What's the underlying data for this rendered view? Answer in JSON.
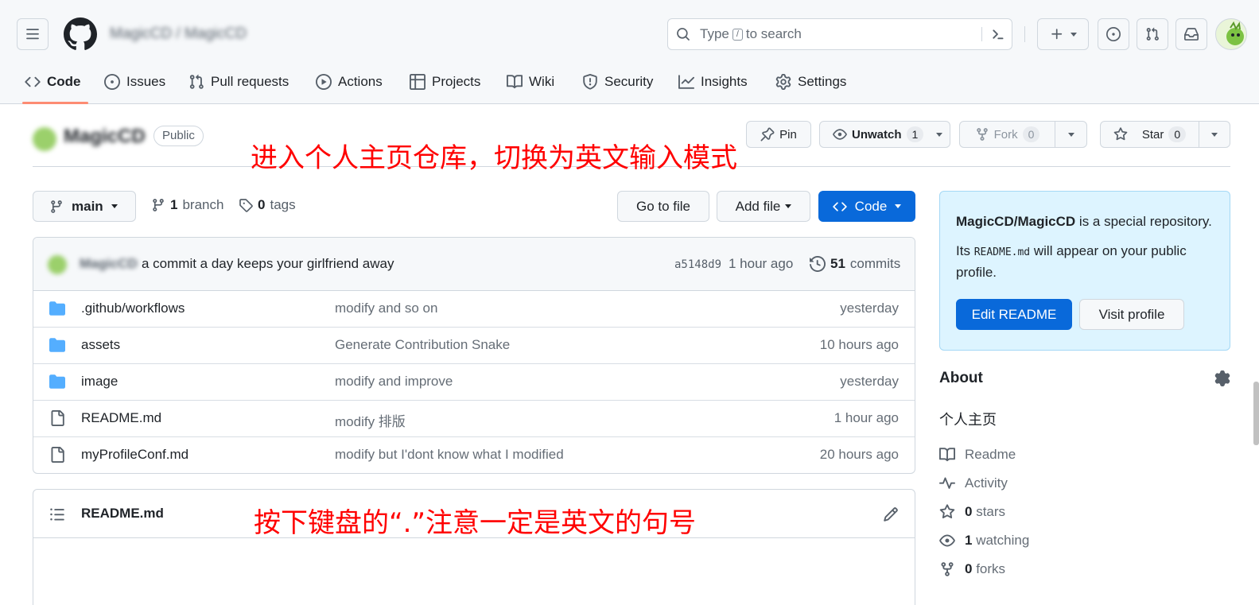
{
  "header": {
    "repo_path": "MagicCD / MagicCD",
    "search_text_before": "Type",
    "search_key": "/",
    "search_text_after": "to search"
  },
  "tabs": [
    {
      "label": "Code"
    },
    {
      "label": "Issues"
    },
    {
      "label": "Pull requests"
    },
    {
      "label": "Actions"
    },
    {
      "label": "Projects"
    },
    {
      "label": "Wiki"
    },
    {
      "label": "Security"
    },
    {
      "label": "Insights"
    },
    {
      "label": "Settings"
    }
  ],
  "repo": {
    "name": "MagicCD",
    "visibility": "Public",
    "pin_label": "Pin",
    "unwatch_label": "Unwatch",
    "watch_count": "1",
    "fork_label": "Fork",
    "fork_count": "0",
    "star_label": "Star",
    "star_count": "0"
  },
  "annotations": {
    "top": "进入个人主页仓库，切换为英文输入模式",
    "bottom": "按下键盘的“.”注意一定是英文的句号"
  },
  "branch_bar": {
    "branch_name": "main",
    "branch_count": "1",
    "branch_label": "branch",
    "tag_count": "0",
    "tag_label": "tags",
    "goto_file": "Go to file",
    "add_file": "Add file",
    "code_button": "Code"
  },
  "commit": {
    "author": "MagicCD",
    "message": "a commit a day keeps your girlfriend away",
    "hash": "a5148d9",
    "time": "1 hour ago",
    "count": "51",
    "count_label": "commits"
  },
  "files": [
    {
      "name": ".github/workflows",
      "type": "folder",
      "message": "modify and so on",
      "time": "yesterday"
    },
    {
      "name": "assets",
      "type": "folder",
      "message": "Generate Contribution Snake",
      "time": "10 hours ago"
    },
    {
      "name": "image",
      "type": "folder",
      "message": "modify and improve",
      "time": "yesterday"
    },
    {
      "name": "README.md",
      "type": "file",
      "message": "modify 排版",
      "time": "1 hour ago"
    },
    {
      "name": "myProfileConf.md",
      "type": "file",
      "message": "modify but I'dont know what I modified",
      "time": "20 hours ago"
    }
  ],
  "readme": {
    "title": "README.md"
  },
  "special_repo": {
    "repo_full": "MagicCD/MagicCD",
    "line1_rest": "is a special repository.",
    "line2_prefix": "Its",
    "readme_code": "README.md",
    "line2_rest": "will appear on your public",
    "line3": "profile.",
    "edit_button": "Edit README",
    "visit_button": "Visit profile"
  },
  "about": {
    "heading": "About",
    "description": "个人主页",
    "readme_label": "Readme",
    "activity_label": "Activity",
    "stars_count": "0",
    "stars_label": "stars",
    "watching_count": "1",
    "watching_label": "watching",
    "forks_count": "0",
    "forks_label": "forks"
  },
  "colors": {
    "accent_blue": "#0969da",
    "tab_underline": "#fd8c73",
    "annotation_red": "#ff0000",
    "folder_blue": "#54aeff"
  }
}
